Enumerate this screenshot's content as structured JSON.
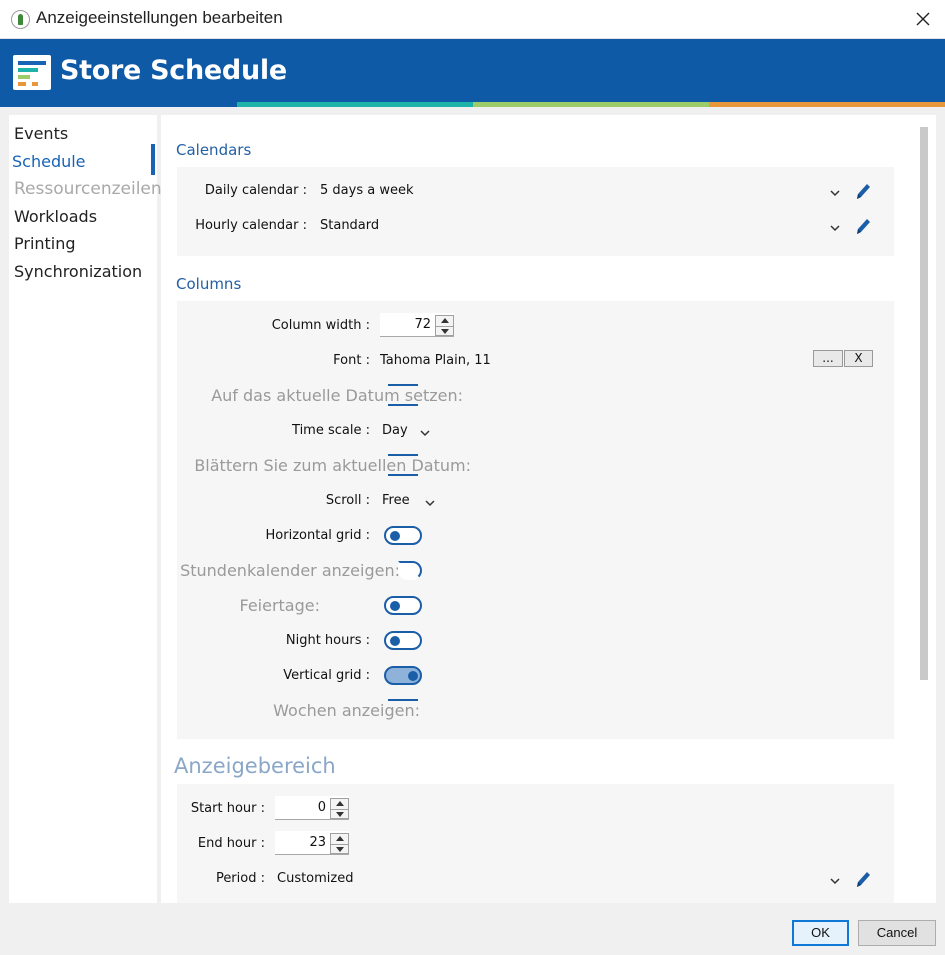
{
  "window": {
    "title": "Anzeigeeinstellungen bearbeiten"
  },
  "banner": {
    "title": "Store Schedule"
  },
  "colors": {
    "brand_blue": "#0e5aa7",
    "accent_teal": "#1db3a8",
    "accent_green": "#9ccc6a",
    "accent_orange": "#e8973a",
    "link_blue": "#1763b6"
  },
  "sidebar": {
    "items": [
      {
        "label": "Events"
      },
      {
        "label": "Schedule"
      },
      {
        "label": "Ressourcenzeilen"
      },
      {
        "label": "Workloads"
      },
      {
        "label": "Printing"
      },
      {
        "label": "Synchronization"
      }
    ],
    "active": "Schedule"
  },
  "calendars": {
    "title": "Calendars",
    "daily_label": "Daily calendar :",
    "daily_value": "5 days a week",
    "hourly_label": "Hourly calendar :",
    "hourly_value": "Standard"
  },
  "columns": {
    "title": "Columns",
    "width_label": "Column width :",
    "width_value": "72",
    "font_label": "Font :",
    "font_value": "Tahoma Plain, 11",
    "font_browse": "...",
    "font_clear": "X",
    "set_today_label": "Auf das aktuelle Datum setzen:",
    "time_scale_label": "Time scale :",
    "time_scale_value": "Day",
    "scroll_today_label": "Blättern Sie zum aktuellen Datum:",
    "scroll_label": "Scroll :",
    "scroll_value": "Free",
    "horizontal_grid_label": "Horizontal grid :",
    "show_hourly_label": "Stundenkalender anzeigen:",
    "holidays_label": "Feiertage:",
    "night_hours_label": "Night hours :",
    "vertical_grid_label": "Vertical grid :",
    "show_weeks_label": "Wochen anzeigen:"
  },
  "display_range": {
    "title": "Anzeigebereich",
    "start_label": "Start hour :",
    "start_value": "0",
    "end_label": "End hour :",
    "end_value": "23",
    "period_label": "Period :",
    "period_value": "Customized"
  },
  "buttons": {
    "ok": "OK",
    "cancel": "Cancel"
  }
}
